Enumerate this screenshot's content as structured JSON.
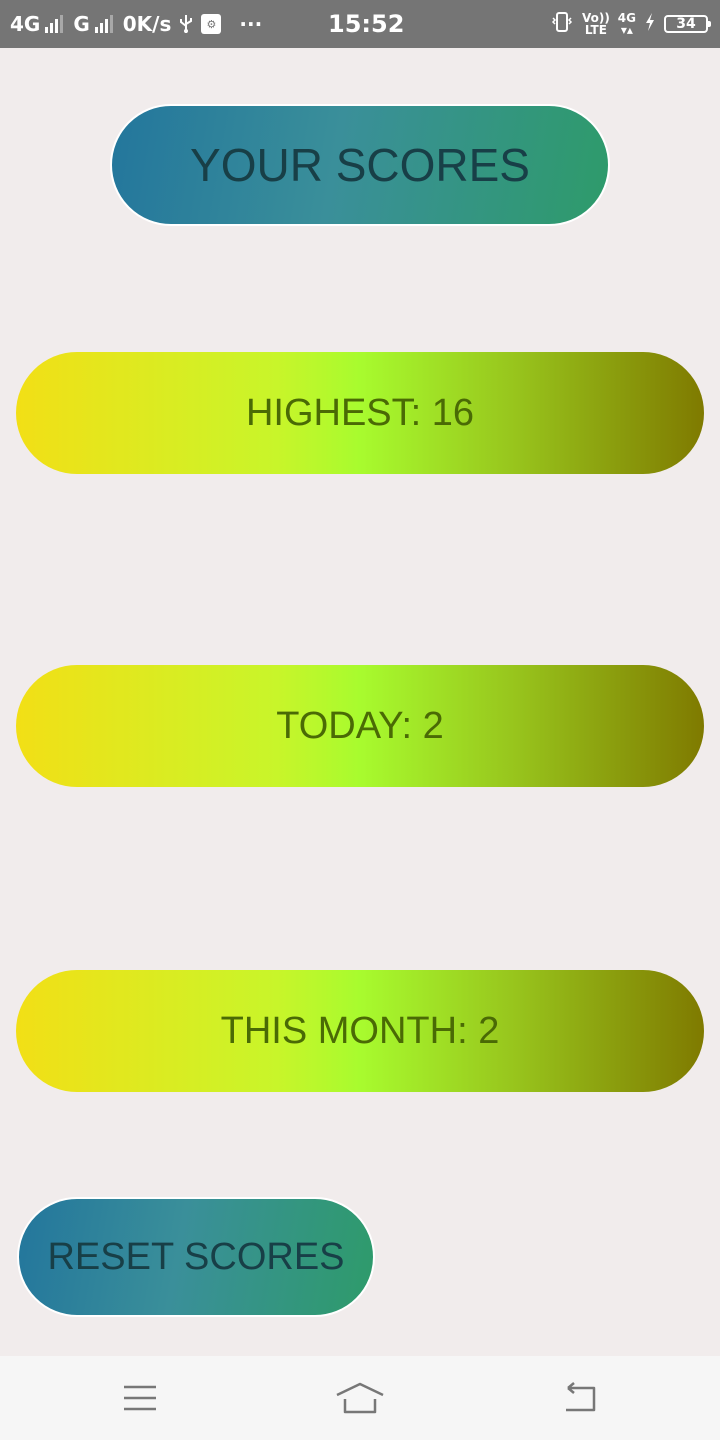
{
  "status_bar": {
    "network1": "4G",
    "network2": "G",
    "speed": "0K/s",
    "more": "···",
    "time": "15:52",
    "volte_top": "Vo))",
    "volte_bottom": "LTE",
    "network3": "4G",
    "battery": "34",
    "icons": [
      "usb-icon",
      "usb-debug-icon",
      "vibrate-icon",
      "charging-icon"
    ]
  },
  "screen": {
    "title": "YOUR SCORES",
    "scores": {
      "highest": "HIGHEST: 16",
      "today": "TODAY: 2",
      "month": "THIS MONTH: 2"
    },
    "reset_button": "RESET SCORES"
  },
  "nav_bar": {
    "icons": [
      "menu-icon",
      "home-icon",
      "back-icon"
    ]
  },
  "colors": {
    "background": "#f1ecec",
    "status_bar": "#757575",
    "blue_pill_start": "#23769c",
    "blue_pill_end": "#2e9b6a",
    "yellow_pill_start": "#f2df16",
    "yellow_pill_mid": "#a8fb2e",
    "yellow_pill_end": "#7f7a00"
  }
}
